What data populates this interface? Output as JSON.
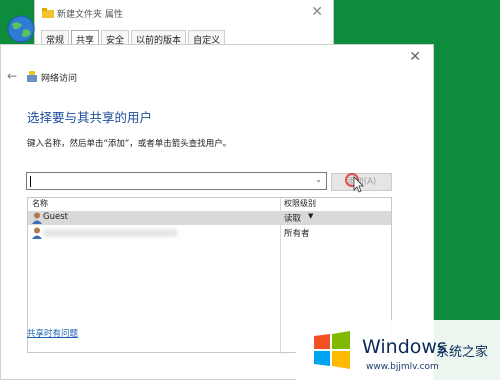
{
  "properties_dialog": {
    "title": "新建文件夹 属性",
    "tabs": [
      "常规",
      "共享",
      "安全",
      "以前的版本",
      "自定义"
    ]
  },
  "dialog": {
    "location_label": "网络访问",
    "heading": "选择要与其共享的用户",
    "instruction": "键入名称，然后单击“添加”，或者单击箭头查找用户。",
    "input_value": "",
    "add_button_label": "添加(A)",
    "columns": {
      "name": "名称",
      "permission": "权限级别"
    },
    "rows": [
      {
        "name": "Guest",
        "permission": "读取",
        "selected": true
      },
      {
        "name": "",
        "permission": "所有者",
        "selected": false
      }
    ],
    "help_link": "共享时有问题"
  },
  "watermark": {
    "brand": "Windows",
    "suffix": "系统之家",
    "url": "www.bjjmlv.com"
  }
}
